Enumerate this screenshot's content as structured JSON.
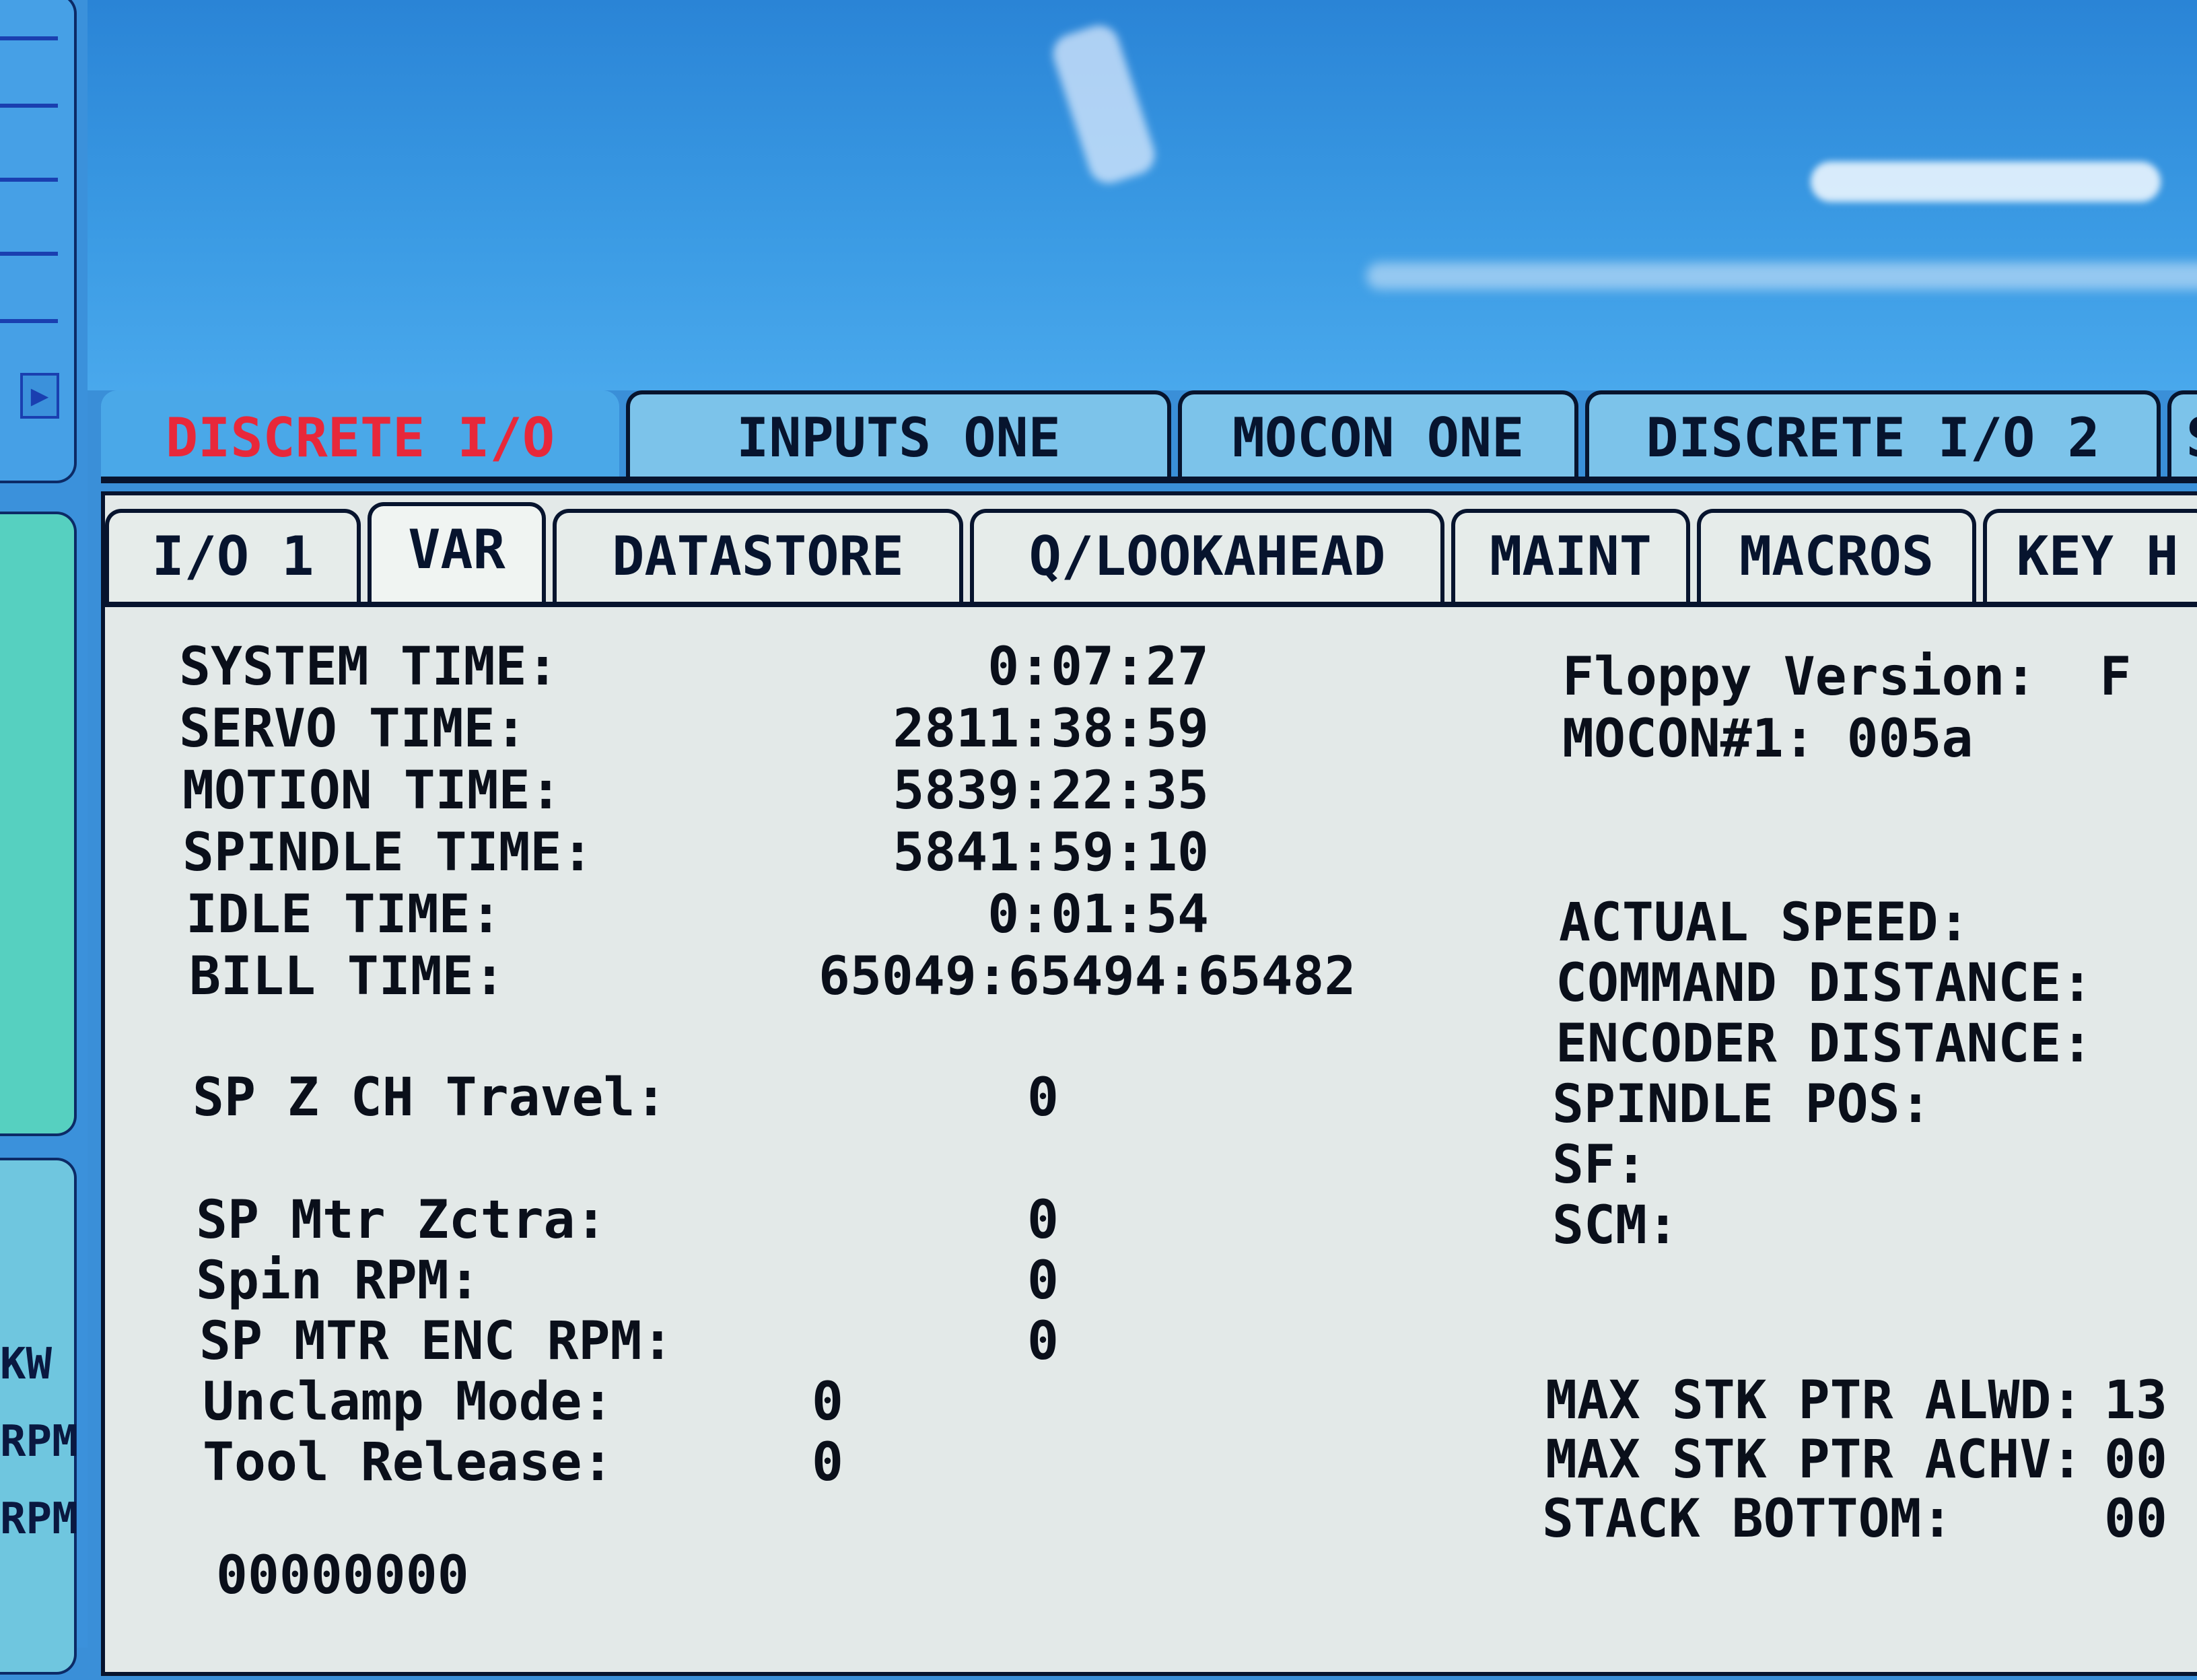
{
  "rail": {
    "labels": [
      "KW",
      "RPM",
      "RPM"
    ],
    "arrow": "▶"
  },
  "tabs_primary": [
    {
      "label": "DISCRETE I/O",
      "active": true
    },
    {
      "label": "INPUTS ONE",
      "active": false
    },
    {
      "label": "MOCON ONE",
      "active": false
    },
    {
      "label": "DISCRETE I/O 2",
      "active": false
    },
    {
      "label": "SER",
      "active": false
    }
  ],
  "tabs_secondary": [
    {
      "label": "I/O 1",
      "active": false
    },
    {
      "label": "VAR",
      "active": true
    },
    {
      "label": "DATASTORE",
      "active": false
    },
    {
      "label": "Q/LOOKAHEAD",
      "active": false
    },
    {
      "label": "MAINT",
      "active": false
    },
    {
      "label": "MACROS",
      "active": false
    },
    {
      "label": "KEY H",
      "active": false
    }
  ],
  "times": [
    {
      "label": "SYSTEM TIME:",
      "value": "0:07:27"
    },
    {
      "label": "SERVO TIME:",
      "value": "2811:38:59"
    },
    {
      "label": "MOTION TIME:",
      "value": "5839:22:35"
    },
    {
      "label": "SPINDLE TIME:",
      "value": "5841:59:10"
    },
    {
      "label": "IDLE TIME:",
      "value": "0:01:54"
    },
    {
      "label": "BILL TIME:",
      "value": "65049:65494:65482"
    }
  ],
  "spindle_stats": [
    {
      "label": "SP Z CH Travel:",
      "value": "0"
    },
    {
      "label": "SP Mtr Zctra:",
      "value": "0"
    },
    {
      "label": "Spin RPM:",
      "value": "0"
    },
    {
      "label": "SP MTR ENC RPM:",
      "value": "0"
    }
  ],
  "tool_stats": [
    {
      "label": "Unclamp Mode:",
      "value": "0"
    },
    {
      "label": "Tool Release:",
      "value": "0"
    }
  ],
  "footer_code": "00000000",
  "right_info": {
    "floppy_version": "Floppy Version:  F",
    "mocon": "MOCON#1: 005a"
  },
  "right_labels": [
    "ACTUAL SPEED:",
    "COMMAND DISTANCE:",
    "ENCODER DISTANCE:",
    "SPINDLE POS:",
    "SF:",
    "SCM:"
  ],
  "stack": [
    {
      "label": "MAX STK PTR ALWD:",
      "value": "13"
    },
    {
      "label": "MAX STK PTR ACHV:",
      "value": "00"
    },
    {
      "label": "STACK BOTTOM:",
      "value": "00"
    }
  ]
}
